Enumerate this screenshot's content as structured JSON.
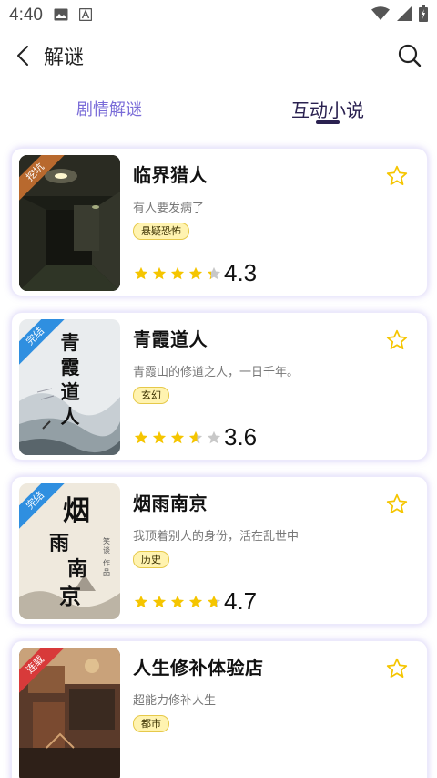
{
  "status": {
    "time": "4:40"
  },
  "header": {
    "title": "解谜"
  },
  "tabs": [
    {
      "label": "剧情解谜",
      "active": false
    },
    {
      "label": "互动小说",
      "active": true
    }
  ],
  "colors": {
    "accent": "#7a6cd8",
    "active_tab": "#2a2150",
    "star": "#f5c500",
    "star_empty": "#c8c8c8"
  },
  "books": [
    {
      "title": "临界猎人",
      "desc": "有人要发病了",
      "tag": "悬疑恐怖",
      "rating": "4.3",
      "rating_num": 4.3,
      "badge": "挖坑",
      "badge_color": "#b8692e"
    },
    {
      "title": "青霞道人",
      "desc": "青霞山的修道之人，一日千年。",
      "tag": "玄幻",
      "rating": "3.6",
      "rating_num": 3.6,
      "badge": "完结",
      "badge_color": "#2f8fe0",
      "cover_text": "青霞道人"
    },
    {
      "title": "烟雨南京",
      "desc": "我顶着别人的身份，活在乱世中",
      "tag": "历史",
      "rating": "4.7",
      "rating_num": 4.7,
      "badge": "完结",
      "badge_color": "#2f8fe0",
      "cover_text": "烟雨南京",
      "cover_small": "笑谈 作品"
    },
    {
      "title": "人生修补体验店",
      "desc": "超能力修补人生",
      "tag": "都市",
      "badge": "连载",
      "badge_color": "#d83a3a"
    }
  ]
}
